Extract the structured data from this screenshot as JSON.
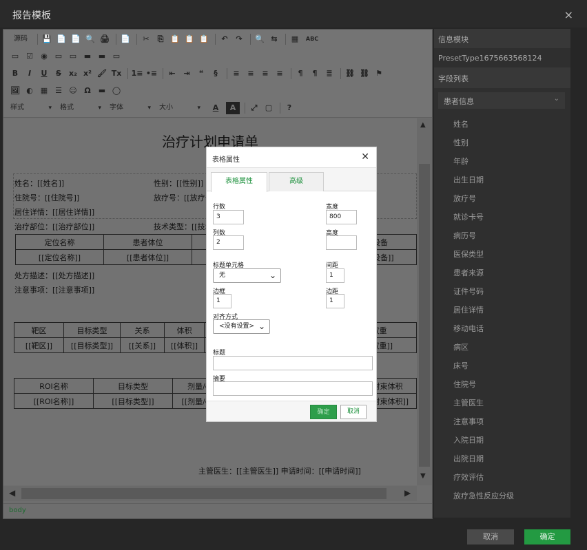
{
  "window": {
    "title": "报告模板",
    "close": "×"
  },
  "toolbar": {
    "source_label": "源码",
    "row1": [
      "💾",
      "📄",
      "📄",
      "🔍",
      "🖨",
      "📄",
      "✂",
      "⎘",
      "📋",
      "📋",
      "📋",
      "↶",
      "↷",
      "🔍",
      "⇆",
      "▦",
      "ABC"
    ],
    "row2": [
      "▭",
      "☑",
      "◉",
      "▭",
      "▭",
      "▬",
      "▬",
      "▭"
    ],
    "row3": [
      "B",
      "I",
      "U",
      "S",
      "x₂",
      "x²",
      "🖌",
      "Tx",
      "1≡",
      "•≡",
      "⇤",
      "⇥",
      "❝",
      "§",
      "≡",
      "≡",
      "≡",
      "≡",
      "¶",
      "¶",
      "≣",
      "⛓",
      "⛓",
      "⚑"
    ],
    "row4": [
      "🖼",
      "◐",
      "▦",
      "☰",
      "☺",
      "Ω",
      "▬",
      "◯"
    ],
    "combos": [
      "样式",
      "格式",
      "字体",
      "大小"
    ],
    "row5_extra": [
      "A",
      "A",
      "⤢",
      "▢",
      "?"
    ]
  },
  "document": {
    "title": "治疗计划申请单",
    "lines": {
      "name": "姓名：[[姓名]]",
      "gender": "性别：[[性别]]",
      "inpatient": "住院号：[[住院号]]",
      "radio_no": "放疗号：[[放疗号]]",
      "address": "居住详情：[[居住详情]]",
      "site": "治疗部位：[[治疗部位]]",
      "tech": "技术类型：[[技术类型]]",
      "prescription": "处方描述：[[处方描述]]",
      "notes": "注意事项：[[注意事项]]",
      "footer": "主管医生：[[主管医生]]  申请时间：[[申请时间]]"
    },
    "table1": {
      "headers": [
        "定位名称",
        "患者体位",
        "",
        "定位设备"
      ],
      "cells": [
        "[[定位名称]]",
        "[[患者体位]]",
        "",
        "[[定位设备]]"
      ]
    },
    "table2": {
      "headers": [
        "靶区",
        "目标类型",
        "关系",
        "体积",
        "",
        "",
        "",
        "权重"
      ],
      "cells": [
        "[[靶区]]",
        "[[目标类型]]",
        "[[关系]]",
        "[[体积]]",
        "",
        "",
        "",
        "[[权重]]"
      ]
    },
    "table3": {
      "headers": [
        "ROI名称",
        "目标类型",
        "剂量/cGy",
        "",
        "",
        "射束体积"
      ],
      "cells": [
        "[[ROI名称]]",
        "[[目标类型]]",
        "[[剂量/cGy]]",
        "",
        "",
        "[[射束体积]]"
      ]
    }
  },
  "status_bar": {
    "path": "body"
  },
  "right_panel": {
    "section_title": "信息模块",
    "preset": "PresetType1675663568124",
    "fields_title": "字段列表",
    "group": "患者信息",
    "items": [
      "姓名",
      "性别",
      "年龄",
      "出生日期",
      "放疗号",
      "就诊卡号",
      "病历号",
      "医保类型",
      "患者来源",
      "证件号码",
      "居住详情",
      "移动电话",
      "病区",
      "床号",
      "住院号",
      "主管医生",
      "注意事项",
      "入院日期",
      "出院日期",
      "疗效评估",
      "放疗急性反应分级"
    ]
  },
  "dialog": {
    "title": "表格属性",
    "tabs": [
      "表格属性",
      "高级"
    ],
    "rows_label": "行数",
    "rows_value": "3",
    "cols_label": "列数",
    "cols_value": "2",
    "width_label": "宽度",
    "width_value": "800",
    "height_label": "高度",
    "height_value": "",
    "header_label": "标题单元格",
    "header_value": "无",
    "spacing_label": "间距",
    "spacing_value": "1",
    "border_label": "边框",
    "border_value": "1",
    "padding_label": "边距",
    "padding_value": "1",
    "align_label": "对齐方式",
    "align_value": "<没有设置>",
    "caption_label": "标题",
    "caption_value": "",
    "summary_label": "摘要",
    "summary_value": "",
    "ok": "确定",
    "cancel": "取消"
  },
  "footer": {
    "cancel": "取消",
    "ok": "确定"
  }
}
